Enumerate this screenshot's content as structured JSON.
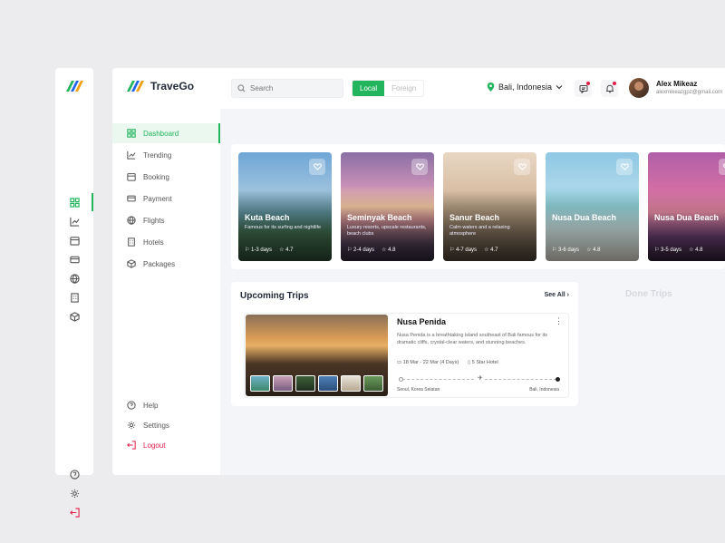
{
  "app": {
    "name": "TraveGo"
  },
  "search": {
    "placeholder": "Search"
  },
  "scope_toggle": {
    "local": "Local",
    "foreign": "Foreign"
  },
  "location": {
    "label": "Bali, Indonesia"
  },
  "user": {
    "name": "Alex Mikeaz",
    "email": "alexmikeazgpz@gmail.com"
  },
  "nav": {
    "items": [
      {
        "label": "Dashboard",
        "icon": "dashboard-icon",
        "active": true
      },
      {
        "label": "Trending",
        "icon": "trending-icon"
      },
      {
        "label": "Booking",
        "icon": "booking-icon"
      },
      {
        "label": "Payment",
        "icon": "payment-icon"
      },
      {
        "label": "Flights",
        "icon": "globe-icon"
      },
      {
        "label": "Hotels",
        "icon": "hotel-icon"
      },
      {
        "label": "Packages",
        "icon": "package-icon"
      }
    ],
    "bottom": [
      {
        "label": "Help",
        "icon": "help-icon"
      },
      {
        "label": "Settings",
        "icon": "gear-icon"
      },
      {
        "label": "Logout",
        "icon": "logout-icon"
      }
    ]
  },
  "destinations": [
    {
      "title": "Kuta Beach",
      "desc": "Famous for its surfing and nightlife",
      "days": "1-3 days",
      "rating": "4.7"
    },
    {
      "title": "Seminyak Beach",
      "desc": "Luxury resorts, upscale restaurants, beach clubs",
      "days": "2-4 days",
      "rating": "4.8"
    },
    {
      "title": "Sanur Beach",
      "desc": "Calm waters and a relaxing atmosphere",
      "days": "4-7 days",
      "rating": "4.7"
    },
    {
      "title": "Nusa Dua Beach",
      "desc": "",
      "days": "3-6 days",
      "rating": "4.8"
    },
    {
      "title": "Nusa Dua Beach",
      "desc": "",
      "days": "3-5 days",
      "rating": "4.8"
    }
  ],
  "upcoming": {
    "title": "Upcoming Trips",
    "see_all": "See All",
    "trip": {
      "name": "Nusa Penida",
      "desc": "Nusa Penida is a breathtaking island southeast of Bali famous for its dramatic cliffs, crystal-clear waters, and stunning beaches.",
      "dates": "18 Mar - 22 Mar (4 Days)",
      "hotel": "5 Star Hotel",
      "from": "Seoul, Korea Selatan",
      "to": "Bali, Indonesia"
    }
  },
  "done": {
    "title": "Done Trips"
  },
  "colors": {
    "accent": "#22b55e",
    "danger": "#e11d48"
  }
}
